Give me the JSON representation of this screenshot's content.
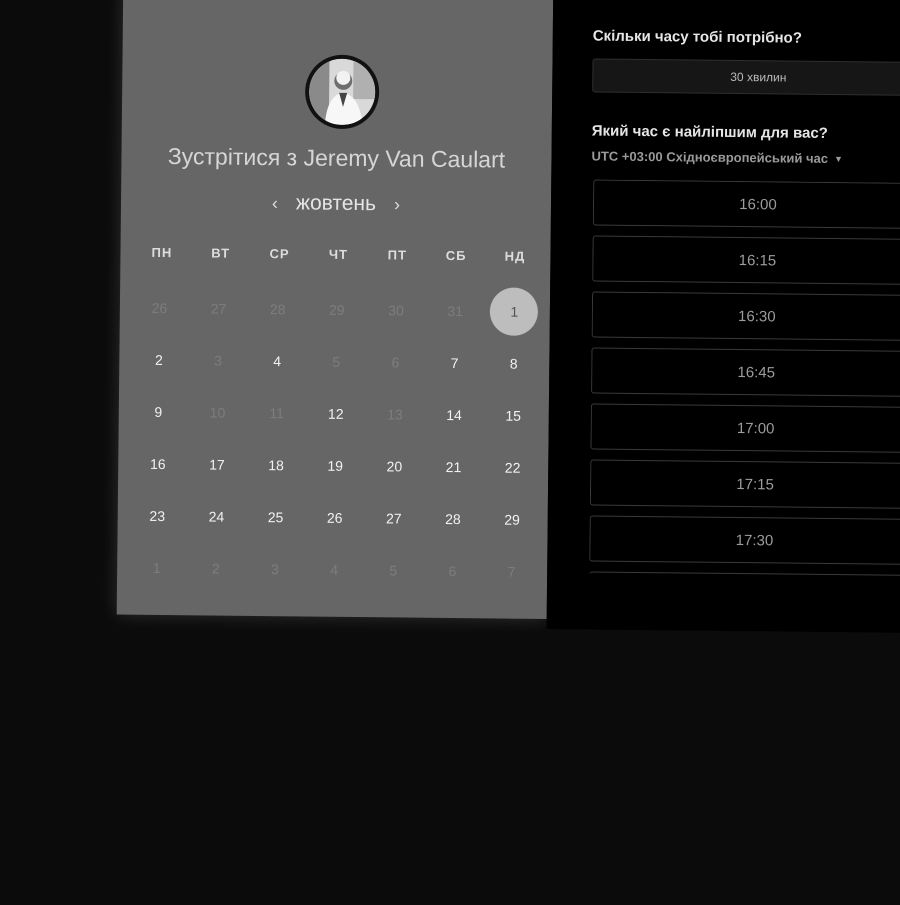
{
  "calendar": {
    "title": "Зустрітися з Jeremy Van Caulart",
    "month": "жовтень",
    "prev_label": "‹",
    "next_label": "›",
    "weekdays": [
      "ПН",
      "ВТ",
      "СР",
      "ЧТ",
      "ПТ",
      "СБ",
      "НД"
    ],
    "days": [
      {
        "n": "26",
        "state": "muted"
      },
      {
        "n": "27",
        "state": "muted"
      },
      {
        "n": "28",
        "state": "muted"
      },
      {
        "n": "29",
        "state": "muted"
      },
      {
        "n": "30",
        "state": "muted"
      },
      {
        "n": "31",
        "state": "muted"
      },
      {
        "n": "1",
        "state": "selected"
      },
      {
        "n": "2",
        "state": "active"
      },
      {
        "n": "3",
        "state": "muted"
      },
      {
        "n": "4",
        "state": "active"
      },
      {
        "n": "5",
        "state": "muted"
      },
      {
        "n": "6",
        "state": "muted"
      },
      {
        "n": "7",
        "state": "active"
      },
      {
        "n": "8",
        "state": "active"
      },
      {
        "n": "9",
        "state": "active"
      },
      {
        "n": "10",
        "state": "muted"
      },
      {
        "n": "11",
        "state": "muted"
      },
      {
        "n": "12",
        "state": "active"
      },
      {
        "n": "13",
        "state": "muted"
      },
      {
        "n": "14",
        "state": "active"
      },
      {
        "n": "15",
        "state": "active"
      },
      {
        "n": "16",
        "state": "active"
      },
      {
        "n": "17",
        "state": "active"
      },
      {
        "n": "18",
        "state": "active"
      },
      {
        "n": "19",
        "state": "active"
      },
      {
        "n": "20",
        "state": "active"
      },
      {
        "n": "21",
        "state": "active"
      },
      {
        "n": "22",
        "state": "active"
      },
      {
        "n": "23",
        "state": "active"
      },
      {
        "n": "24",
        "state": "active"
      },
      {
        "n": "25",
        "state": "active"
      },
      {
        "n": "26",
        "state": "active"
      },
      {
        "n": "27",
        "state": "active"
      },
      {
        "n": "28",
        "state": "active"
      },
      {
        "n": "29",
        "state": "active"
      },
      {
        "n": "1",
        "state": "muted"
      },
      {
        "n": "2",
        "state": "muted"
      },
      {
        "n": "3",
        "state": "muted"
      },
      {
        "n": "4",
        "state": "muted"
      },
      {
        "n": "5",
        "state": "muted"
      },
      {
        "n": "6",
        "state": "muted"
      },
      {
        "n": "7",
        "state": "muted"
      }
    ]
  },
  "booking": {
    "duration_question": "Скільки часу тобі потрібно?",
    "duration_value": "30 хвилин",
    "time_question": "Який час є найліпшим для вас?",
    "timezone": "UTC +03:00 Східноєвропейський час",
    "slots": [
      "16:00",
      "16:15",
      "16:30",
      "16:45",
      "17:00",
      "17:15",
      "17:30",
      ""
    ]
  },
  "colors": {
    "left_panel": "#666666",
    "right_panel": "#000000",
    "page_background": "#0b0b0b",
    "selected_day": "#bdbdbd"
  }
}
